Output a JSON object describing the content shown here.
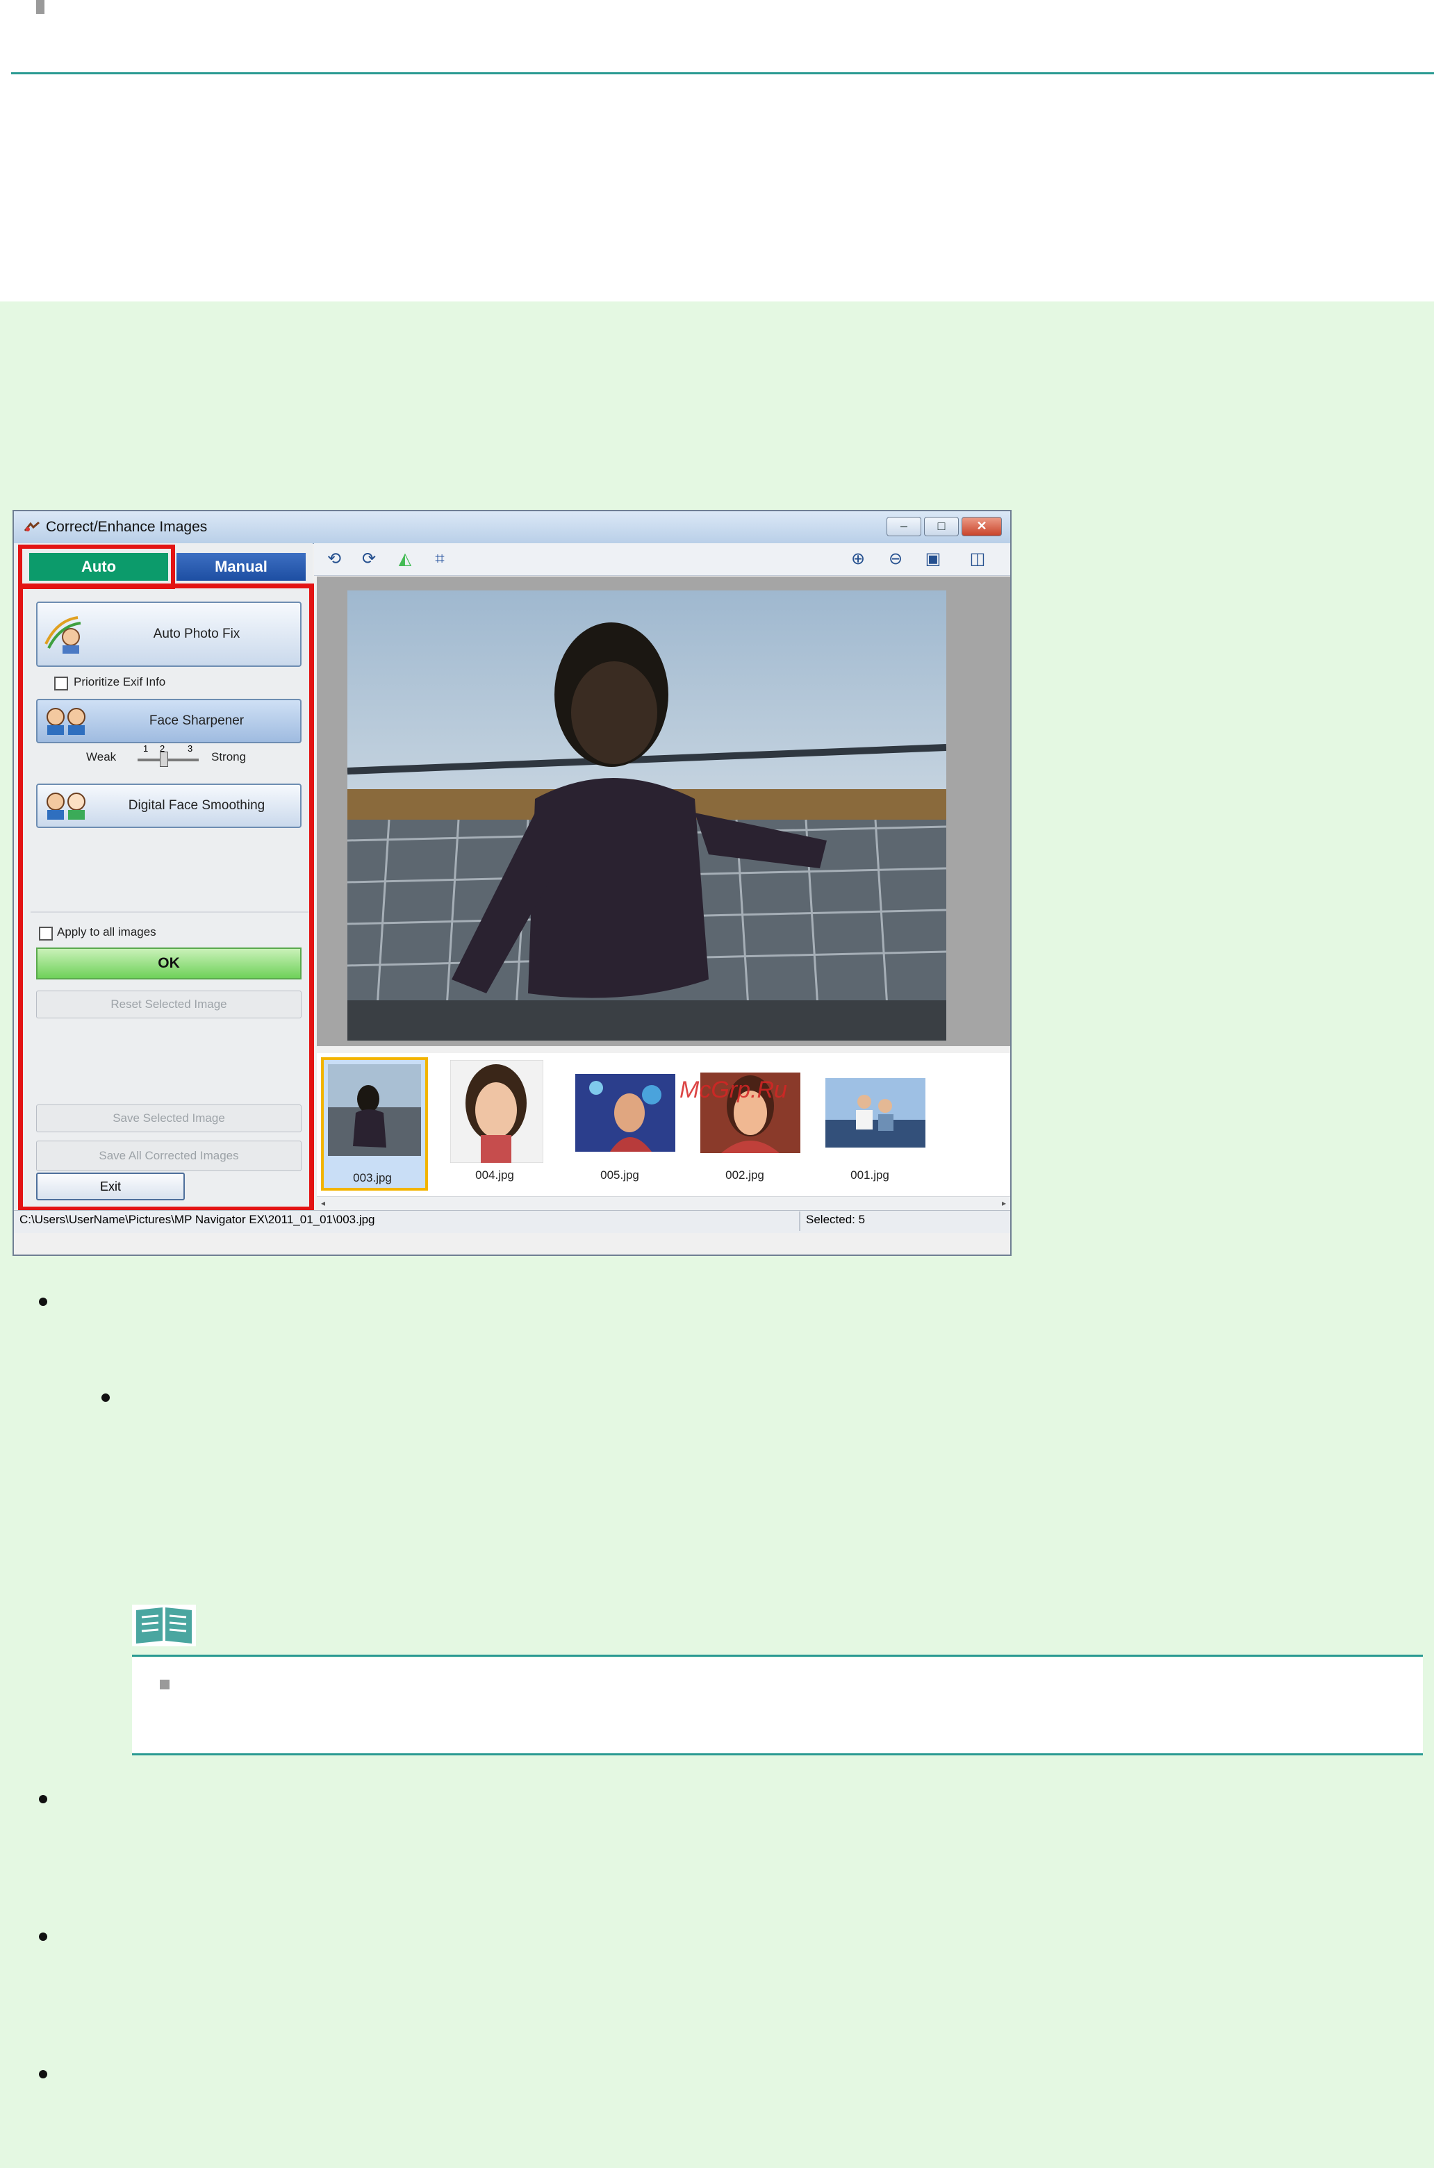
{
  "window": {
    "title": "Correct/Enhance Images",
    "minimize_label": "–",
    "maximize_label": "□",
    "close_label": "✕"
  },
  "tabs": [
    {
      "label": "Auto",
      "active": true
    },
    {
      "label": "Manual",
      "active": false
    }
  ],
  "auto_panel": {
    "auto_photo_fix_label": "Auto Photo Fix",
    "prioritize_exif_label": "Prioritize Exif Info",
    "prioritize_exif_checked": false,
    "face_sharpener_label": "Face Sharpener",
    "slider": {
      "weak_label": "Weak",
      "strong_label": "Strong",
      "ticks": [
        "1",
        "2",
        "3"
      ],
      "value": 2
    },
    "digital_face_smoothing_label": "Digital Face Smoothing",
    "apply_all_label": "Apply to all images",
    "apply_all_checked": false,
    "ok_label": "OK",
    "reset_label": "Reset Selected Image",
    "save_selected_label": "Save Selected Image",
    "save_all_label": "Save All Corrected Images",
    "exit_label": "Exit"
  },
  "toolbar": {
    "left_icons": [
      "rotate-left-icon",
      "rotate-right-icon",
      "flip-icon",
      "crop-icon"
    ],
    "right_icons": [
      "zoom-in-icon",
      "zoom-out-icon",
      "fit-image-icon",
      "compare-view-icon"
    ]
  },
  "thumbnails": [
    {
      "caption": "003.jpg",
      "selected": true
    },
    {
      "caption": "004.jpg",
      "selected": false
    },
    {
      "caption": "005.jpg",
      "selected": false
    },
    {
      "caption": "002.jpg",
      "selected": false
    },
    {
      "caption": "001.jpg",
      "selected": false
    }
  ],
  "status": {
    "path": "C:\\Users\\UserName\\Pictures\\MP Navigator EX\\2011_01_01\\003.jpg",
    "selected": "Selected: 5"
  },
  "watermark": "McGrp.Ru",
  "colors": {
    "highlight_frame": "#e31414",
    "page_background": "#e4f8e2",
    "rule": "#2a9a92",
    "auto_tab": "#0c9b6b",
    "manual_tab": "#1d4ea2"
  }
}
